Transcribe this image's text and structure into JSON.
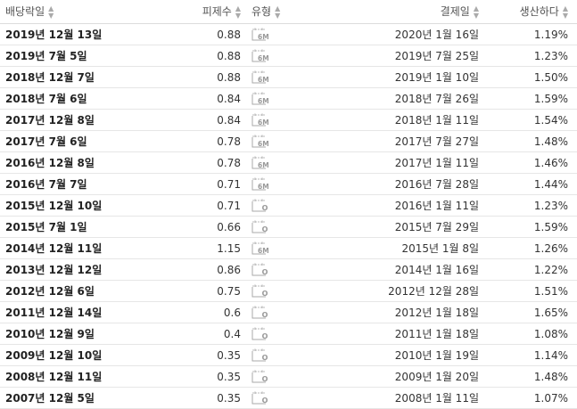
{
  "headers": {
    "ex_date": "배당락일",
    "amount": "피제수",
    "type": "유형",
    "pay_date": "결제일",
    "yield": "생산하다"
  },
  "rows": [
    {
      "ex_date": "2019년 12월 13일",
      "amount": "0.88",
      "type": "6M",
      "pay_date": "2020년 1월 16일",
      "yield": "1.19%"
    },
    {
      "ex_date": "2019년 7월 5일",
      "amount": "0.88",
      "type": "6M",
      "pay_date": "2019년 7월 25일",
      "yield": "1.23%"
    },
    {
      "ex_date": "2018년 12월 7일",
      "amount": "0.88",
      "type": "6M",
      "pay_date": "2019년 1월 10일",
      "yield": "1.50%"
    },
    {
      "ex_date": "2018년 7월 6일",
      "amount": "0.84",
      "type": "6M",
      "pay_date": "2018년 7월 26일",
      "yield": "1.59%"
    },
    {
      "ex_date": "2017년 12월 8일",
      "amount": "0.84",
      "type": "6M",
      "pay_date": "2018년 1월 11일",
      "yield": "1.54%"
    },
    {
      "ex_date": "2017년 7월 6일",
      "amount": "0.78",
      "type": "6M",
      "pay_date": "2017년 7월 27일",
      "yield": "1.48%"
    },
    {
      "ex_date": "2016년 12월 8일",
      "amount": "0.78",
      "type": "6M",
      "pay_date": "2017년 1월 11일",
      "yield": "1.46%"
    },
    {
      "ex_date": "2016년 7월 7일",
      "amount": "0.71",
      "type": "6M",
      "pay_date": "2016년 7월 28일",
      "yield": "1.44%"
    },
    {
      "ex_date": "2015년 12월 10일",
      "amount": "0.71",
      "type": "O",
      "pay_date": "2016년 1월 11일",
      "yield": "1.23%"
    },
    {
      "ex_date": "2015년 7월 1일",
      "amount": "0.66",
      "type": "O",
      "pay_date": "2015년 7월 29일",
      "yield": "1.59%"
    },
    {
      "ex_date": "2014년 12월 11일",
      "amount": "1.15",
      "type": "6M",
      "pay_date": "2015년 1월 8일",
      "yield": "1.26%"
    },
    {
      "ex_date": "2013년 12월 12일",
      "amount": "0.86",
      "type": "O",
      "pay_date": "2014년 1월 16일",
      "yield": "1.22%"
    },
    {
      "ex_date": "2012년 12월 6일",
      "amount": "0.75",
      "type": "O",
      "pay_date": "2012년 12월 28일",
      "yield": "1.51%"
    },
    {
      "ex_date": "2011년 12월 14일",
      "amount": "0.6",
      "type": "O",
      "pay_date": "2012년 1월 18일",
      "yield": "1.65%"
    },
    {
      "ex_date": "2010년 12월 9일",
      "amount": "0.4",
      "type": "O",
      "pay_date": "2011년 1월 18일",
      "yield": "1.08%"
    },
    {
      "ex_date": "2009년 12월 10일",
      "amount": "0.35",
      "type": "O",
      "pay_date": "2010년 1월 19일",
      "yield": "1.14%"
    },
    {
      "ex_date": "2008년 12월 11일",
      "amount": "0.35",
      "type": "O",
      "pay_date": "2009년 1월 20일",
      "yield": "1.48%"
    },
    {
      "ex_date": "2007년 12월 5일",
      "amount": "0.35",
      "type": "O",
      "pay_date": "2008년 1월 11일",
      "yield": "1.07%"
    }
  ],
  "icons": {
    "sort": "sort-arrows-icon",
    "type_icon": "calendar-icon"
  },
  "colors": {
    "text": "#333333",
    "icon": "#999999",
    "border": "#e6e6e6"
  }
}
